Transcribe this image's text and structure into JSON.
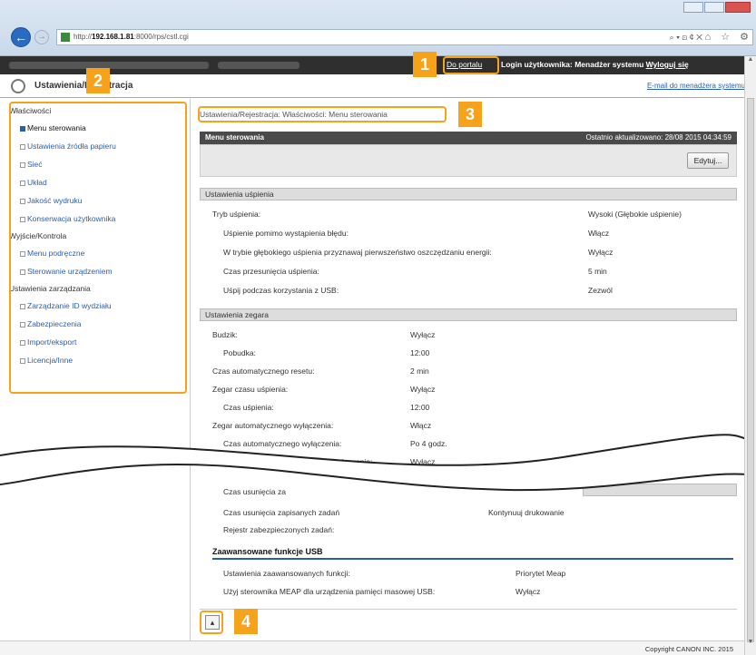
{
  "browser": {
    "url_host": "192.168.1.81",
    "url_prefix": "http://",
    "url_rest": ":8000/rps/cstl.cgi",
    "search_glyphs": "⌕ ▾ ⊡ ¢ ✕",
    "toolbar_glyphs": "⌂ ☆ ⚙"
  },
  "header": {
    "portal_link": "Do portalu",
    "login_text": "Login użytkownika: Menadżer systemu",
    "logout": "Wyloguj się",
    "page_title": "Ustawienia/Rejestracja",
    "admin_email": "E-mail do menadżera systemu"
  },
  "sidebar": {
    "groups": [
      {
        "label": "Właściwości",
        "items": [
          "Menu sterowania",
          "Ustawienia źródła papieru",
          "Sieć",
          "Układ",
          "Jakość wydruku",
          "Konserwacja użytkownika"
        ]
      },
      {
        "label": "Wyjście/Kontrola",
        "items": [
          "Menu podręczne",
          "Sterowanie urządzeniem"
        ]
      },
      {
        "label": "Ustawienia zarządzania",
        "items": [
          "Zarządzanie ID wydziału",
          "Zabezpieczenia",
          "Import/eksport",
          "Licencja/Inne"
        ]
      }
    ]
  },
  "main": {
    "breadcrumb": "Ustawienia/Rejestracja: Właściwości: Menu sterowania",
    "panel_title": "Menu sterowania",
    "last_updated": "Ostatnio aktualizowano: 28/08 2015 04:34:59",
    "edit_button": "Edytuj...",
    "sleep_section": "Ustawienia uśpienia",
    "sleep_rows": [
      {
        "label": "Tryb uśpienia:",
        "value": "Wysoki (Głębokie uśpienie)"
      },
      {
        "label": "Uśpienie pomimo wystąpienia błędu:",
        "value": "Włącz"
      },
      {
        "label": "W trybie głębokiego uśpienia przyznawaj pierwszeństwo oszczędzaniu energii:",
        "value": "Wyłącz"
      },
      {
        "label": "Czas przesunięcia uśpienia:",
        "value": "5 min"
      },
      {
        "label": "Uśpij podczas korzystania z USB:",
        "value": "Zezwól"
      }
    ],
    "clock_section": "Ustawienia zegara",
    "clock_rows": [
      {
        "label": "Budzik:",
        "value": "Wyłącz"
      },
      {
        "label": "Pobudka:",
        "value": "12:00"
      },
      {
        "label": "Czas automatycznego resetu:",
        "value": "2 min"
      },
      {
        "label": "Zegar czasu uśpienia:",
        "value": "Wyłącz"
      },
      {
        "label": "Czas uśpienia:",
        "value": "12:00"
      },
      {
        "label": "Zegar automatycznego wyłączenia:",
        "value": "Włącz"
      },
      {
        "label": "Czas automatycznego wyłączenia:",
        "value": "Po 4 godz."
      },
      {
        "label": "Automatyczny tygodniowy czas wyłączenia:",
        "value": "Wyłącz"
      }
    ],
    "lower_rows": [
      {
        "label": "Czas usunięcia za",
        "value": ""
      },
      {
        "label": "Czas usunięcia zapisanych zadań",
        "value": "Kontynuuj drukowanie"
      },
      {
        "label": "Rejestr zabezpieczonych zadań:",
        "value": ""
      }
    ],
    "usb_section": "Zaawansowane funkcje USB",
    "usb_rows": [
      {
        "label": "Ustawienia zaawansowanych funkcji:",
        "value": "Priorytet Meap"
      },
      {
        "label": "Użyj sterownika MEAP dla urządzenia pamięci masowej USB:",
        "value": "Wyłącz"
      }
    ],
    "copyright": "Copyright CANON INC. 2015"
  },
  "callouts": [
    "1",
    "2",
    "3",
    "4"
  ],
  "colors": {
    "callout": "#f7a21b",
    "link": "#2a5fa8",
    "header_bg": "#2f2f2f"
  }
}
